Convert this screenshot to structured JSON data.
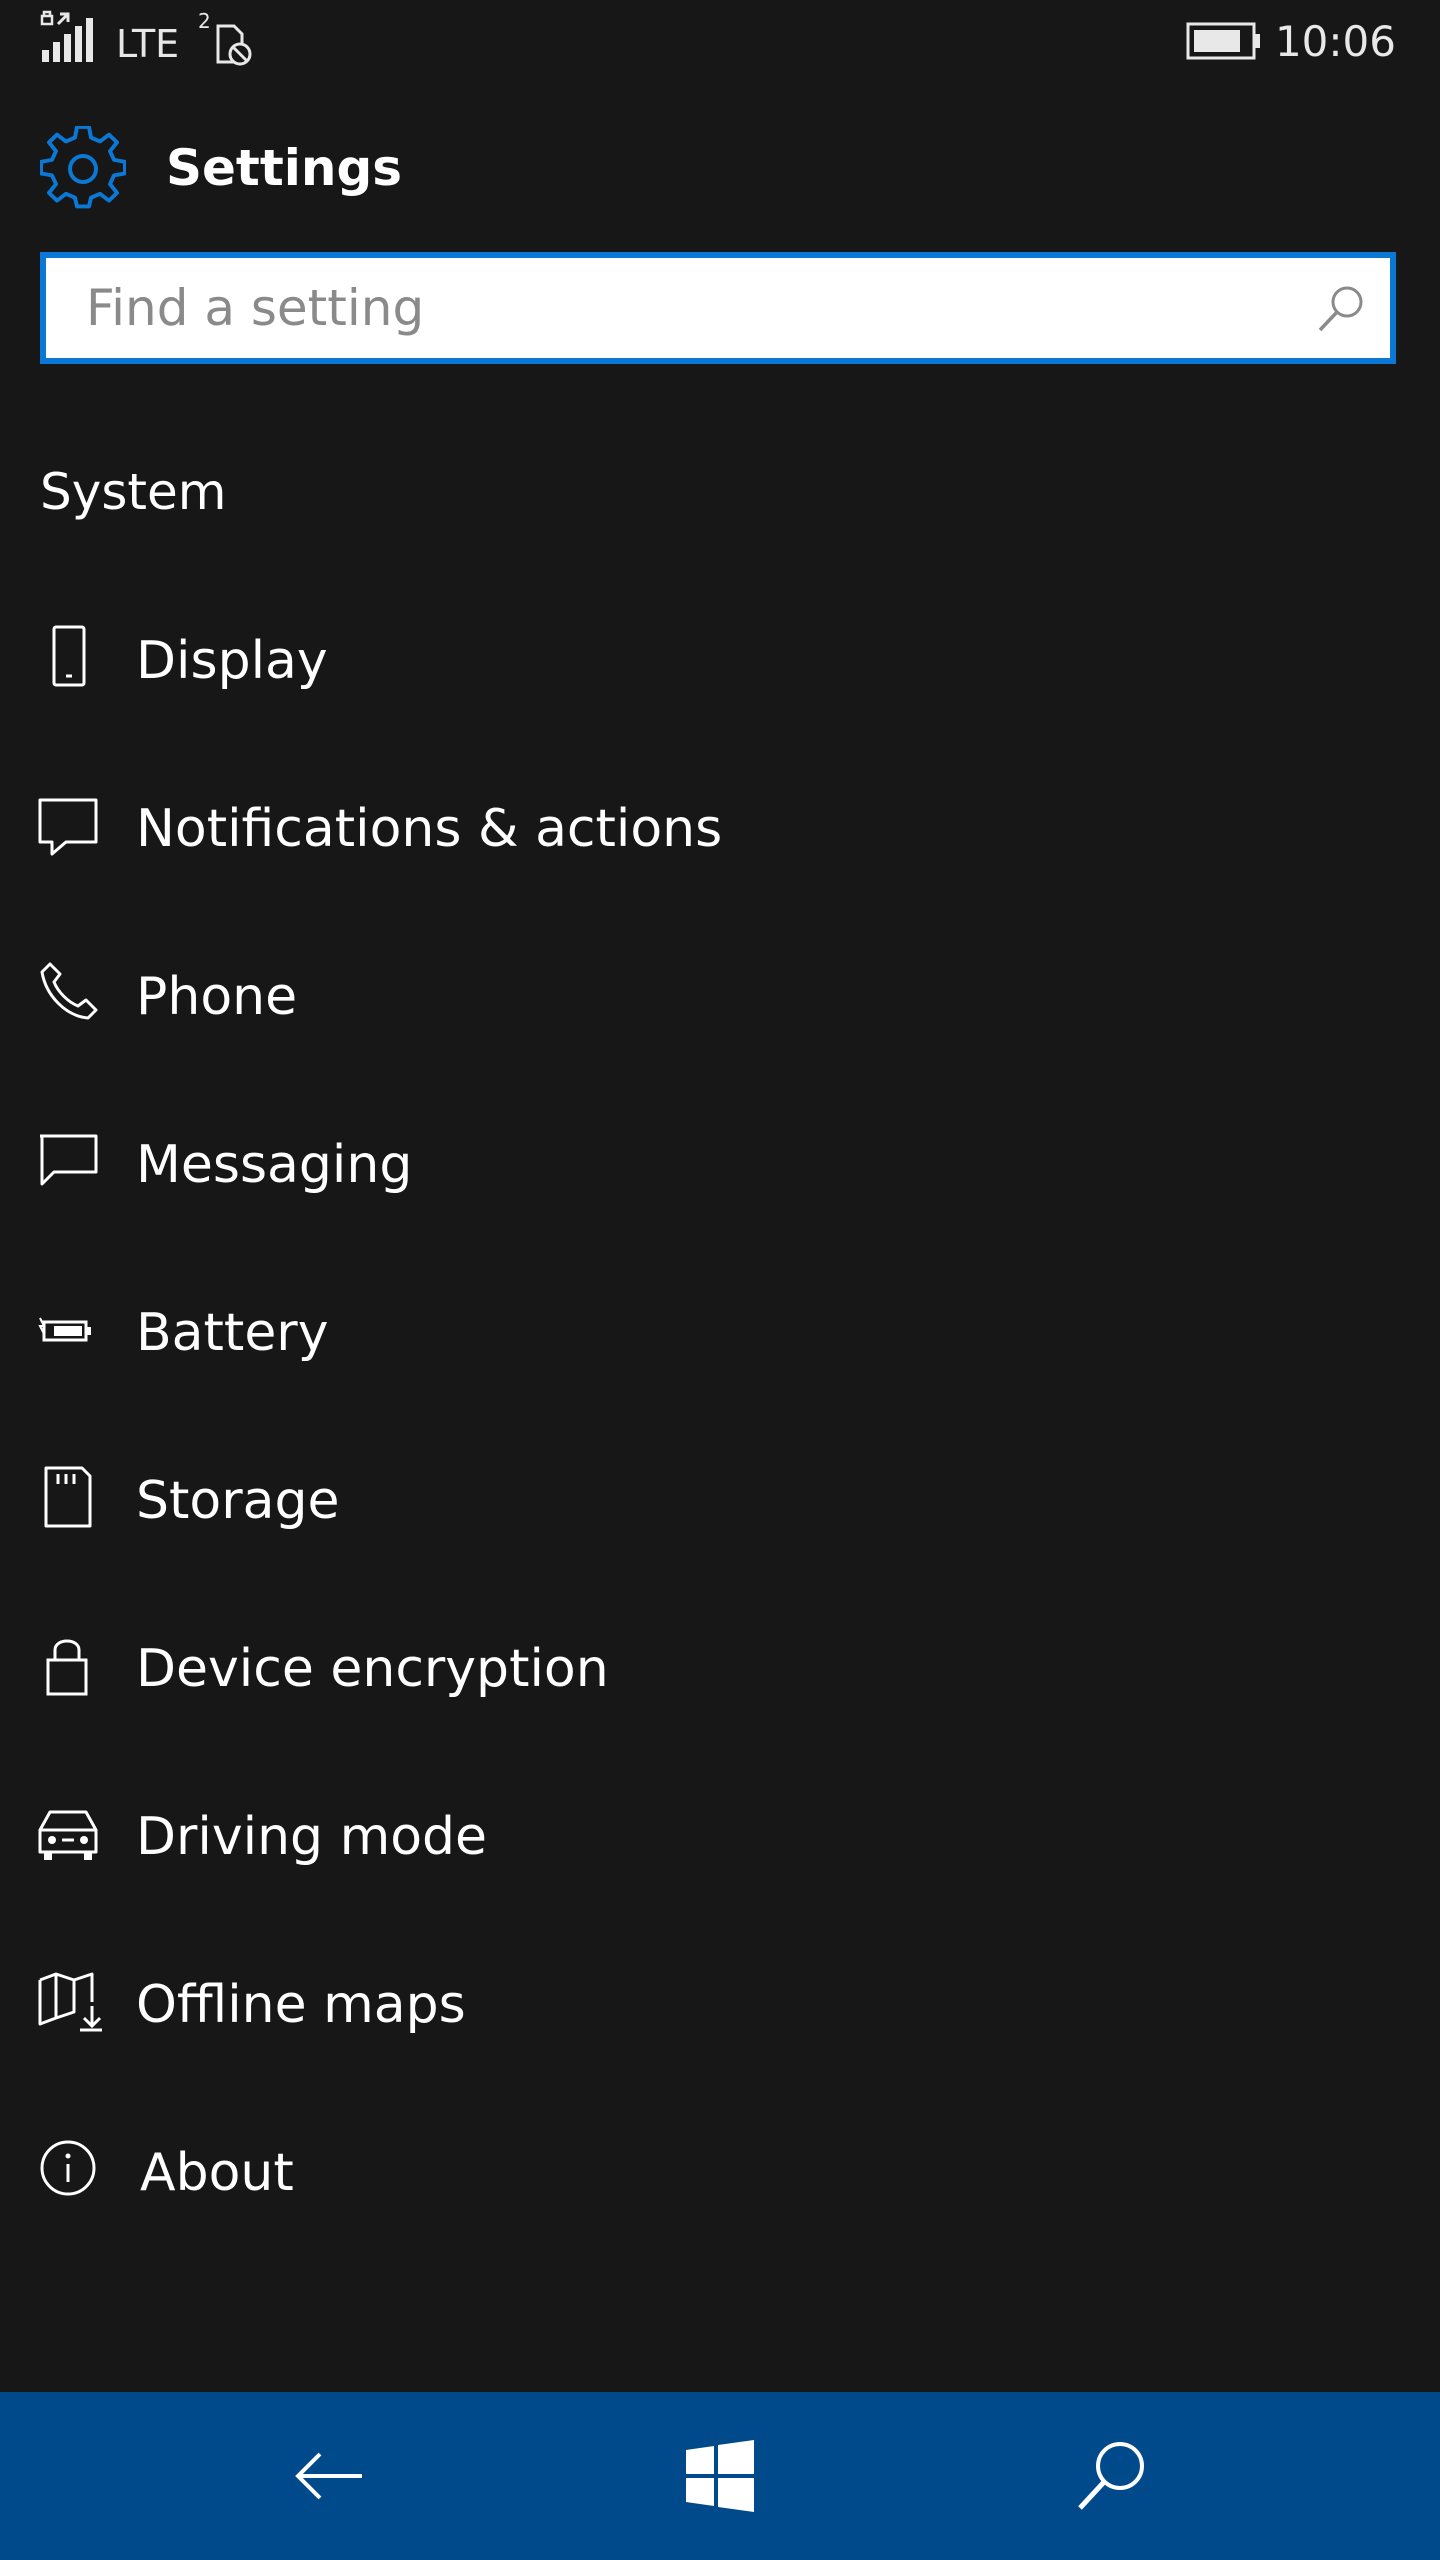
{
  "status_bar": {
    "network": "LTE",
    "time": "10:06",
    "icons": [
      "signal-strength-icon",
      "sim-card-icon",
      "battery-icon"
    ]
  },
  "header": {
    "title": "Settings",
    "icon": "gear-icon",
    "accent_color": "#0a78d4"
  },
  "search": {
    "placeholder": "Find a setting",
    "value": ""
  },
  "section": {
    "title": "System",
    "items": [
      {
        "label": "Display",
        "icon": "phone-display-icon"
      },
      {
        "label": "Notifications & actions",
        "icon": "notification-icon"
      },
      {
        "label": "Phone",
        "icon": "phone-handset-icon"
      },
      {
        "label": "Messaging",
        "icon": "message-bubble-icon"
      },
      {
        "label": "Battery",
        "icon": "battery-saver-icon"
      },
      {
        "label": "Storage",
        "icon": "sd-card-icon"
      },
      {
        "label": "Device encryption",
        "icon": "lock-icon"
      },
      {
        "label": "Driving mode",
        "icon": "car-icon"
      },
      {
        "label": "Offline maps",
        "icon": "map-download-icon"
      },
      {
        "label": "About",
        "icon": "info-icon"
      }
    ]
  },
  "nav_bar": {
    "background": "#004a8c",
    "buttons": [
      "back-arrow-icon",
      "windows-start-icon",
      "search-icon"
    ]
  }
}
